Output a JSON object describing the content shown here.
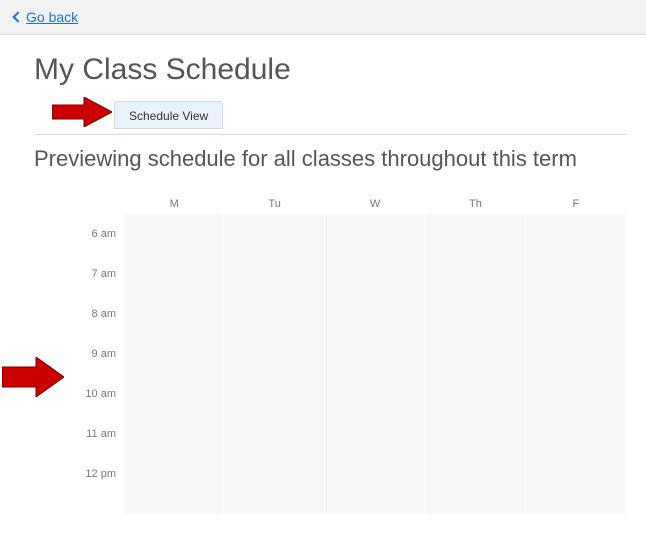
{
  "topbar": {
    "go_back": "Go back"
  },
  "page": {
    "title": "My Class Schedule",
    "tab_label": "Schedule View",
    "subtitle": "Previewing schedule for all classes throughout this term"
  },
  "schedule": {
    "days": [
      "M",
      "Tu",
      "W",
      "Th",
      "F"
    ],
    "times": [
      "6 am",
      "7 am",
      "8 am",
      "9 am",
      "10 am",
      "11 am",
      "12 pm"
    ]
  }
}
